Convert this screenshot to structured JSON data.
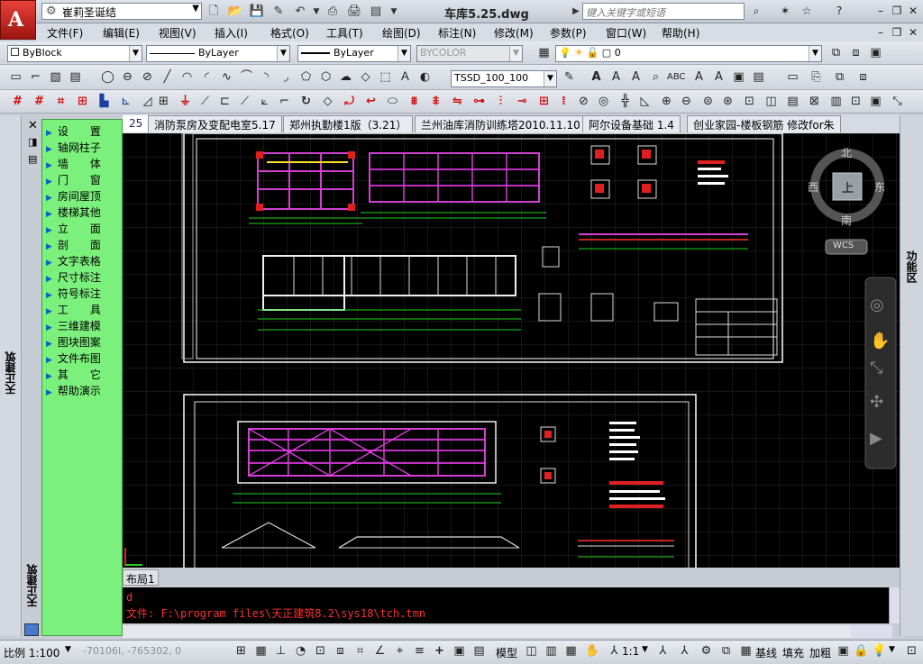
{
  "title_bar": {
    "workspace": "崔莉圣诞结",
    "document_title": "车库5.25.dwg",
    "search_placeholder": "键入关键字或短语"
  },
  "menu": [
    "文件(F)",
    "编辑(E)",
    "视图(V)",
    "插入(I)",
    "格式(O)",
    "工具(T)",
    "绘图(D)",
    "标注(N)",
    "修改(M)",
    "参数(P)",
    "窗口(W)",
    "帮助(H)"
  ],
  "toolbar_row1": {
    "color": "ByBlock",
    "linetype": "ByLayer",
    "lineweight": "ByLayer",
    "plot_style": "BYCOLOR",
    "layer": "0"
  },
  "toolbar_row2": {
    "dim_style": "TSSD_100_100"
  },
  "palette": {
    "title": "天正建筑",
    "items": [
      "设　　置",
      "轴网柱子",
      "墙　　体",
      "门　　窗",
      "房间屋顶",
      "楼梯其他",
      "立　　面",
      "剖　　面",
      "文字表格",
      "尺寸标注",
      "符号标注",
      "工　　具",
      "三维建模",
      "图块图案",
      "文件布图",
      "其　　它",
      "帮助演示"
    ]
  },
  "tabs": [
    "25",
    "消防泵房及变配电室5.17",
    "郑州执勤楼1版（3.21）",
    "兰州油库消防训练塔2010.11.10",
    "阿尔设备基础 1.4",
    "创业家园-楼板钢筋 修改for朱"
  ],
  "viewcube": {
    "north": "北",
    "south": "南",
    "west": "西",
    "east": "东",
    "center": "上",
    "wcs": "WCS"
  },
  "right_panel_label": "功能区",
  "layout_tab": "布局1",
  "command": {
    "line1": "d",
    "line2": "文件: F:\\program files\\天正建筑8.2\\sys18\\tch.tmn"
  },
  "status": {
    "scale": "比例 1:100",
    "coords": "-70106I, -765302, 0",
    "model": "模型",
    "annotation_scale": "1:1",
    "baseline": "基线",
    "fill": "填充",
    "bold": "加粗"
  },
  "colors": {
    "palette_bg": "#7cf07c",
    "drawing_bg": "#000000",
    "command_text": "#ff3030"
  }
}
